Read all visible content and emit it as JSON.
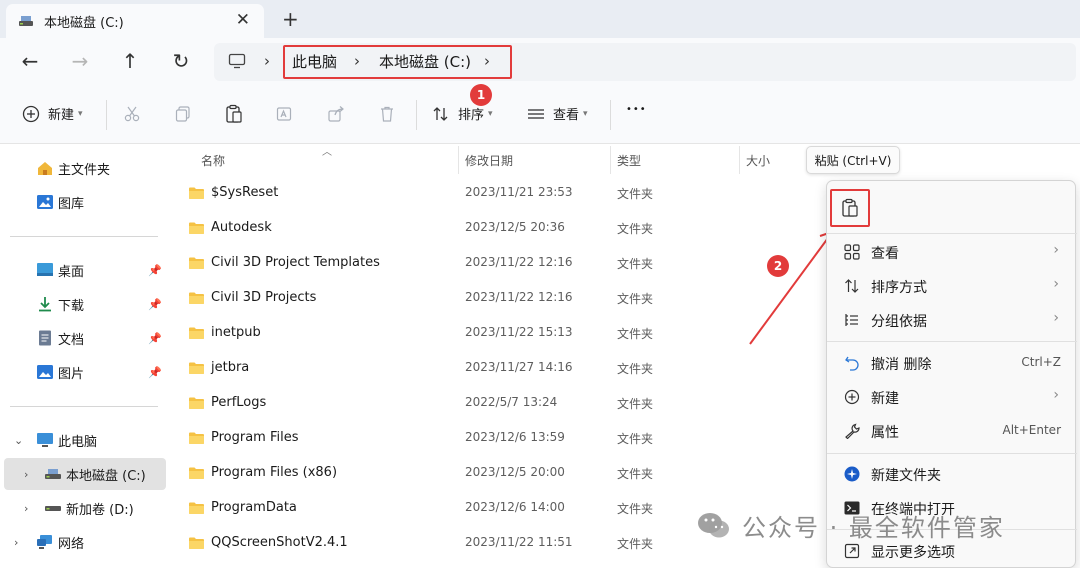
{
  "window": {
    "tab_title": "本地磁盘 (C:)",
    "tab_close": "✕",
    "new_tab": "+"
  },
  "nav": {
    "back": "←",
    "forward": "→",
    "up": "↑",
    "refresh": "↻",
    "breadcrumb_sep": "›",
    "breadcrumbs": [
      "此电脑",
      "本地磁盘 (C:)"
    ]
  },
  "toolbar": {
    "new_label": "新建",
    "sort_label": "排序",
    "view_label": "查看",
    "more_label": "•••"
  },
  "sidebar": {
    "items": [
      {
        "label": "主文件夹"
      },
      {
        "label": "图库"
      },
      {
        "label": "桌面",
        "pinned": true
      },
      {
        "label": "下载",
        "pinned": true
      },
      {
        "label": "文档",
        "pinned": true
      },
      {
        "label": "图片",
        "pinned": true
      },
      {
        "label": "此电脑"
      },
      {
        "label": "本地磁盘 (C:)"
      },
      {
        "label": "新加卷 (D:)"
      },
      {
        "label": "网络"
      }
    ]
  },
  "file_list": {
    "columns": [
      "名称",
      "修改日期",
      "类型",
      "大小"
    ],
    "rows": [
      {
        "name": "$SysReset",
        "date": "2023/11/21 23:53",
        "type": "文件夹"
      },
      {
        "name": "Autodesk",
        "date": "2023/12/5 20:36",
        "type": "文件夹"
      },
      {
        "name": "Civil 3D Project Templates",
        "date": "2023/11/22 12:16",
        "type": "文件夹"
      },
      {
        "name": "Civil 3D Projects",
        "date": "2023/11/22 12:16",
        "type": "文件夹"
      },
      {
        "name": "inetpub",
        "date": "2023/11/22 15:13",
        "type": "文件夹"
      },
      {
        "name": "jetbra",
        "date": "2023/11/27 14:16",
        "type": "文件夹"
      },
      {
        "name": "PerfLogs",
        "date": "2022/5/7 13:24",
        "type": "文件夹"
      },
      {
        "name": "Program Files",
        "date": "2023/12/6 13:59",
        "type": "文件夹"
      },
      {
        "name": "Program Files (x86)",
        "date": "2023/12/5 20:00",
        "type": "文件夹"
      },
      {
        "name": "ProgramData",
        "date": "2023/12/6 14:00",
        "type": "文件夹"
      },
      {
        "name": "QQScreenShotV2.4.1",
        "date": "2023/11/22 11:51",
        "type": "文件夹"
      }
    ]
  },
  "tooltip": {
    "text": "粘贴 (Ctrl+V)"
  },
  "context_menu": {
    "items": [
      {
        "label": "查看",
        "submenu": true
      },
      {
        "label": "排序方式",
        "submenu": true
      },
      {
        "label": "分组依据",
        "submenu": true
      },
      {
        "label": "撤消 删除",
        "accel": "Ctrl+Z"
      },
      {
        "label": "新建",
        "submenu": true
      },
      {
        "label": "属性",
        "accel": "Alt+Enter"
      },
      {
        "label": "新建文件夹"
      },
      {
        "label": "在终端中打开"
      },
      {
        "label": "显示更多选项"
      }
    ]
  },
  "annotations": {
    "marker1": "1",
    "marker2": "2",
    "color": "#e23b3b"
  },
  "watermark": {
    "text": "公众号 · 最全软件管家"
  }
}
